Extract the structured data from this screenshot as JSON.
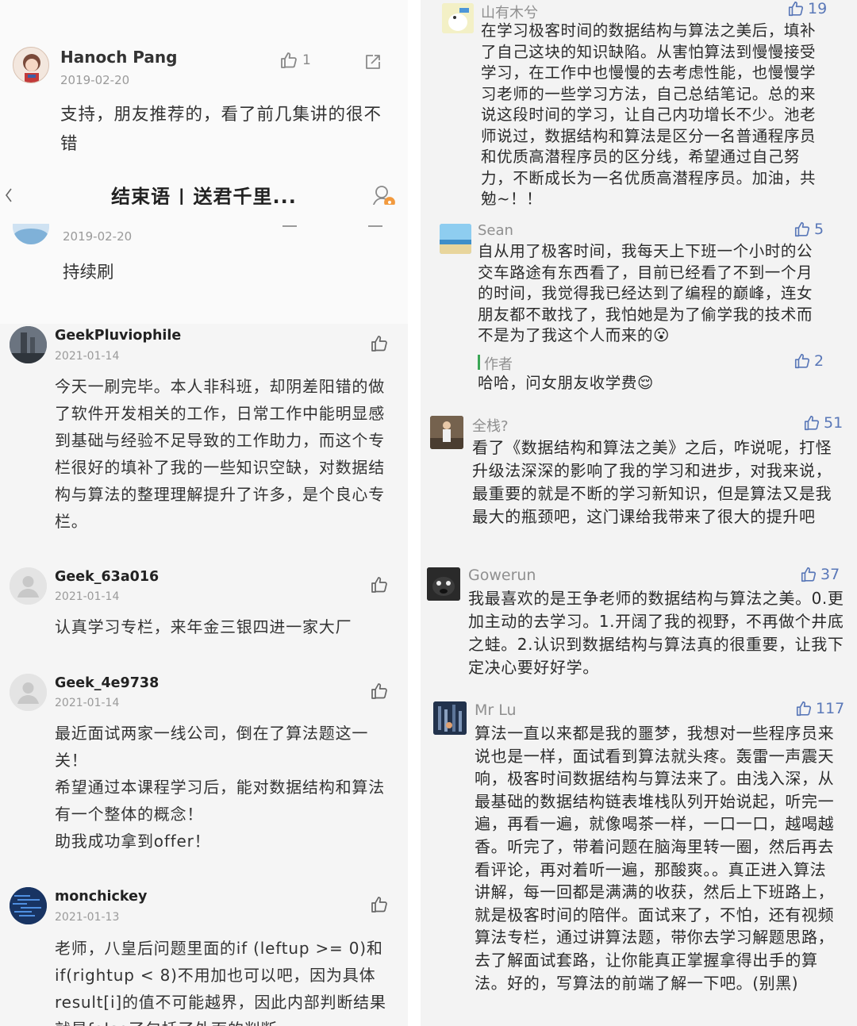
{
  "left": {
    "top_comment": {
      "username": "Hanoch Pang",
      "date": "2019-02-20",
      "like_count": "1",
      "text": "支持，朋友推荐的，看了前几集讲的很不错"
    },
    "article_bar": {
      "title": "结束语 | 送君千里..."
    },
    "partial_comment": {
      "date": "2019-02-20",
      "text": "持续刷"
    },
    "comments": [
      {
        "username": "GeekPluviophile",
        "date": "2021-01-14",
        "text": "今天一刷完毕。本人非科班，却阴差阳错的做了软件开发相关的工作，日常工作中能明显感到基础与经验不足导致的工作助力，而这个专栏很好的填补了我的一些知识空缺，对数据结构与算法的整理理解提升了许多，是个良心专栏。"
      },
      {
        "username": "Geek_63a016",
        "date": "2021-01-14",
        "text": "认真学习专栏，来年金三银四进一家大厂"
      },
      {
        "username": "Geek_4e9738",
        "date": "2021-01-14",
        "lines": [
          "最近面试两家一线公司，倒在了算法题这一关！",
          "希望通过本课程学习后，能对数据结构和算法有一个整体的概念！",
          "助我成功拿到offer！"
        ]
      },
      {
        "username": "monchickey",
        "date": "2021-01-13",
        "text": "老师，八皇后问题里面的if (leftup >= 0)和if(rightup < 8)不用加也可以吧，因为具体result[i]的值不可能越界，因此内部判断结果就是false了包括了外面的判断"
      }
    ]
  },
  "right": {
    "comments": [
      {
        "username": "山有木兮",
        "like_count": "19",
        "text": "在学习极客时间的数据结构与算法之美后，填补了自己这块的知识缺陷。从害怕算法到慢慢接受学习，在工作中也慢慢的去考虑性能，也慢慢学习老师的一些学习方法，自己总结笔记。总的来说这段时间的学习，让自己内功增长不少。池老师说过，数据结构和算法是区分一名普通程序员和优质高潜程序员的区分线，希望通过自己努力，不断成长为一名优质高潜程序员。加油，共勉~！！"
      },
      {
        "username": "Sean",
        "like_count": "5",
        "text": "自从用了极客时间，我每天上下班一个小时的公交车路途有东西看了，目前已经看了不到一个月的时间，我觉得我已经达到了编程的巅峰，连女朋友都不敢找了，我怕她是为了偷学我的技术而不是为了我这个人而来的😮",
        "reply": {
          "label": "作者",
          "like_count": "2",
          "text": "哈哈，问女朋友收学费😌"
        }
      },
      {
        "username": "全栈?",
        "like_count": "51",
        "text": "看了《数据结构和算法之美》之后，咋说呢，打怪升级法深深的影响了我的学习和进步，对我来说，最重要的就是不断的学习新知识，但是算法又是我最大的瓶颈吧，这门课给我带来了很大的提升吧"
      },
      {
        "username": "Gowerun",
        "like_count": "37",
        "text": "我最喜欢的是王争老师的数据结构与算法之美。0.更加主动的去学习。1.开阔了我的视野，不再做个井底之蛙。2.认识到数据结构与算法真的很重要，让我下定决心要好好学。"
      },
      {
        "username": "Mr Lu",
        "like_count": "117",
        "text": "算法一直以来都是我的噩梦，我想对一些程序员来说也是一样，面试看到算法就头疼。轰雷一声震天响，极客时间数据结构与算法来了。由浅入深，从最基础的数据结构链表堆栈队列开始说起，听完一遍，再看一遍，就像喝茶一样，一口一口，越喝越香。听完了，带着问题在脑海里转一圈，然后再去看评论，再对着听一遍，那酸爽。。真正进入算法讲解，每一回都是满满的收获，然后上下班路上，就是极客时间的陪伴。面试来了，不怕，还有视频算法专栏，通过讲算法题，带你去学习解题思路，去了解面试套路，让你能真正掌握拿得出手的算法。好的，写算法的前端了解一下吧。(别黑)"
      }
    ]
  },
  "colors": {
    "left_bg": "#f5f5f5",
    "right_bg": "#f3f3f3",
    "like_blue": "#5a78b8",
    "author_bar": "#3aa655"
  },
  "icons": [
    "thumbs-up-icon",
    "share-icon",
    "user-settings-icon",
    "back-chevron-icon"
  ]
}
